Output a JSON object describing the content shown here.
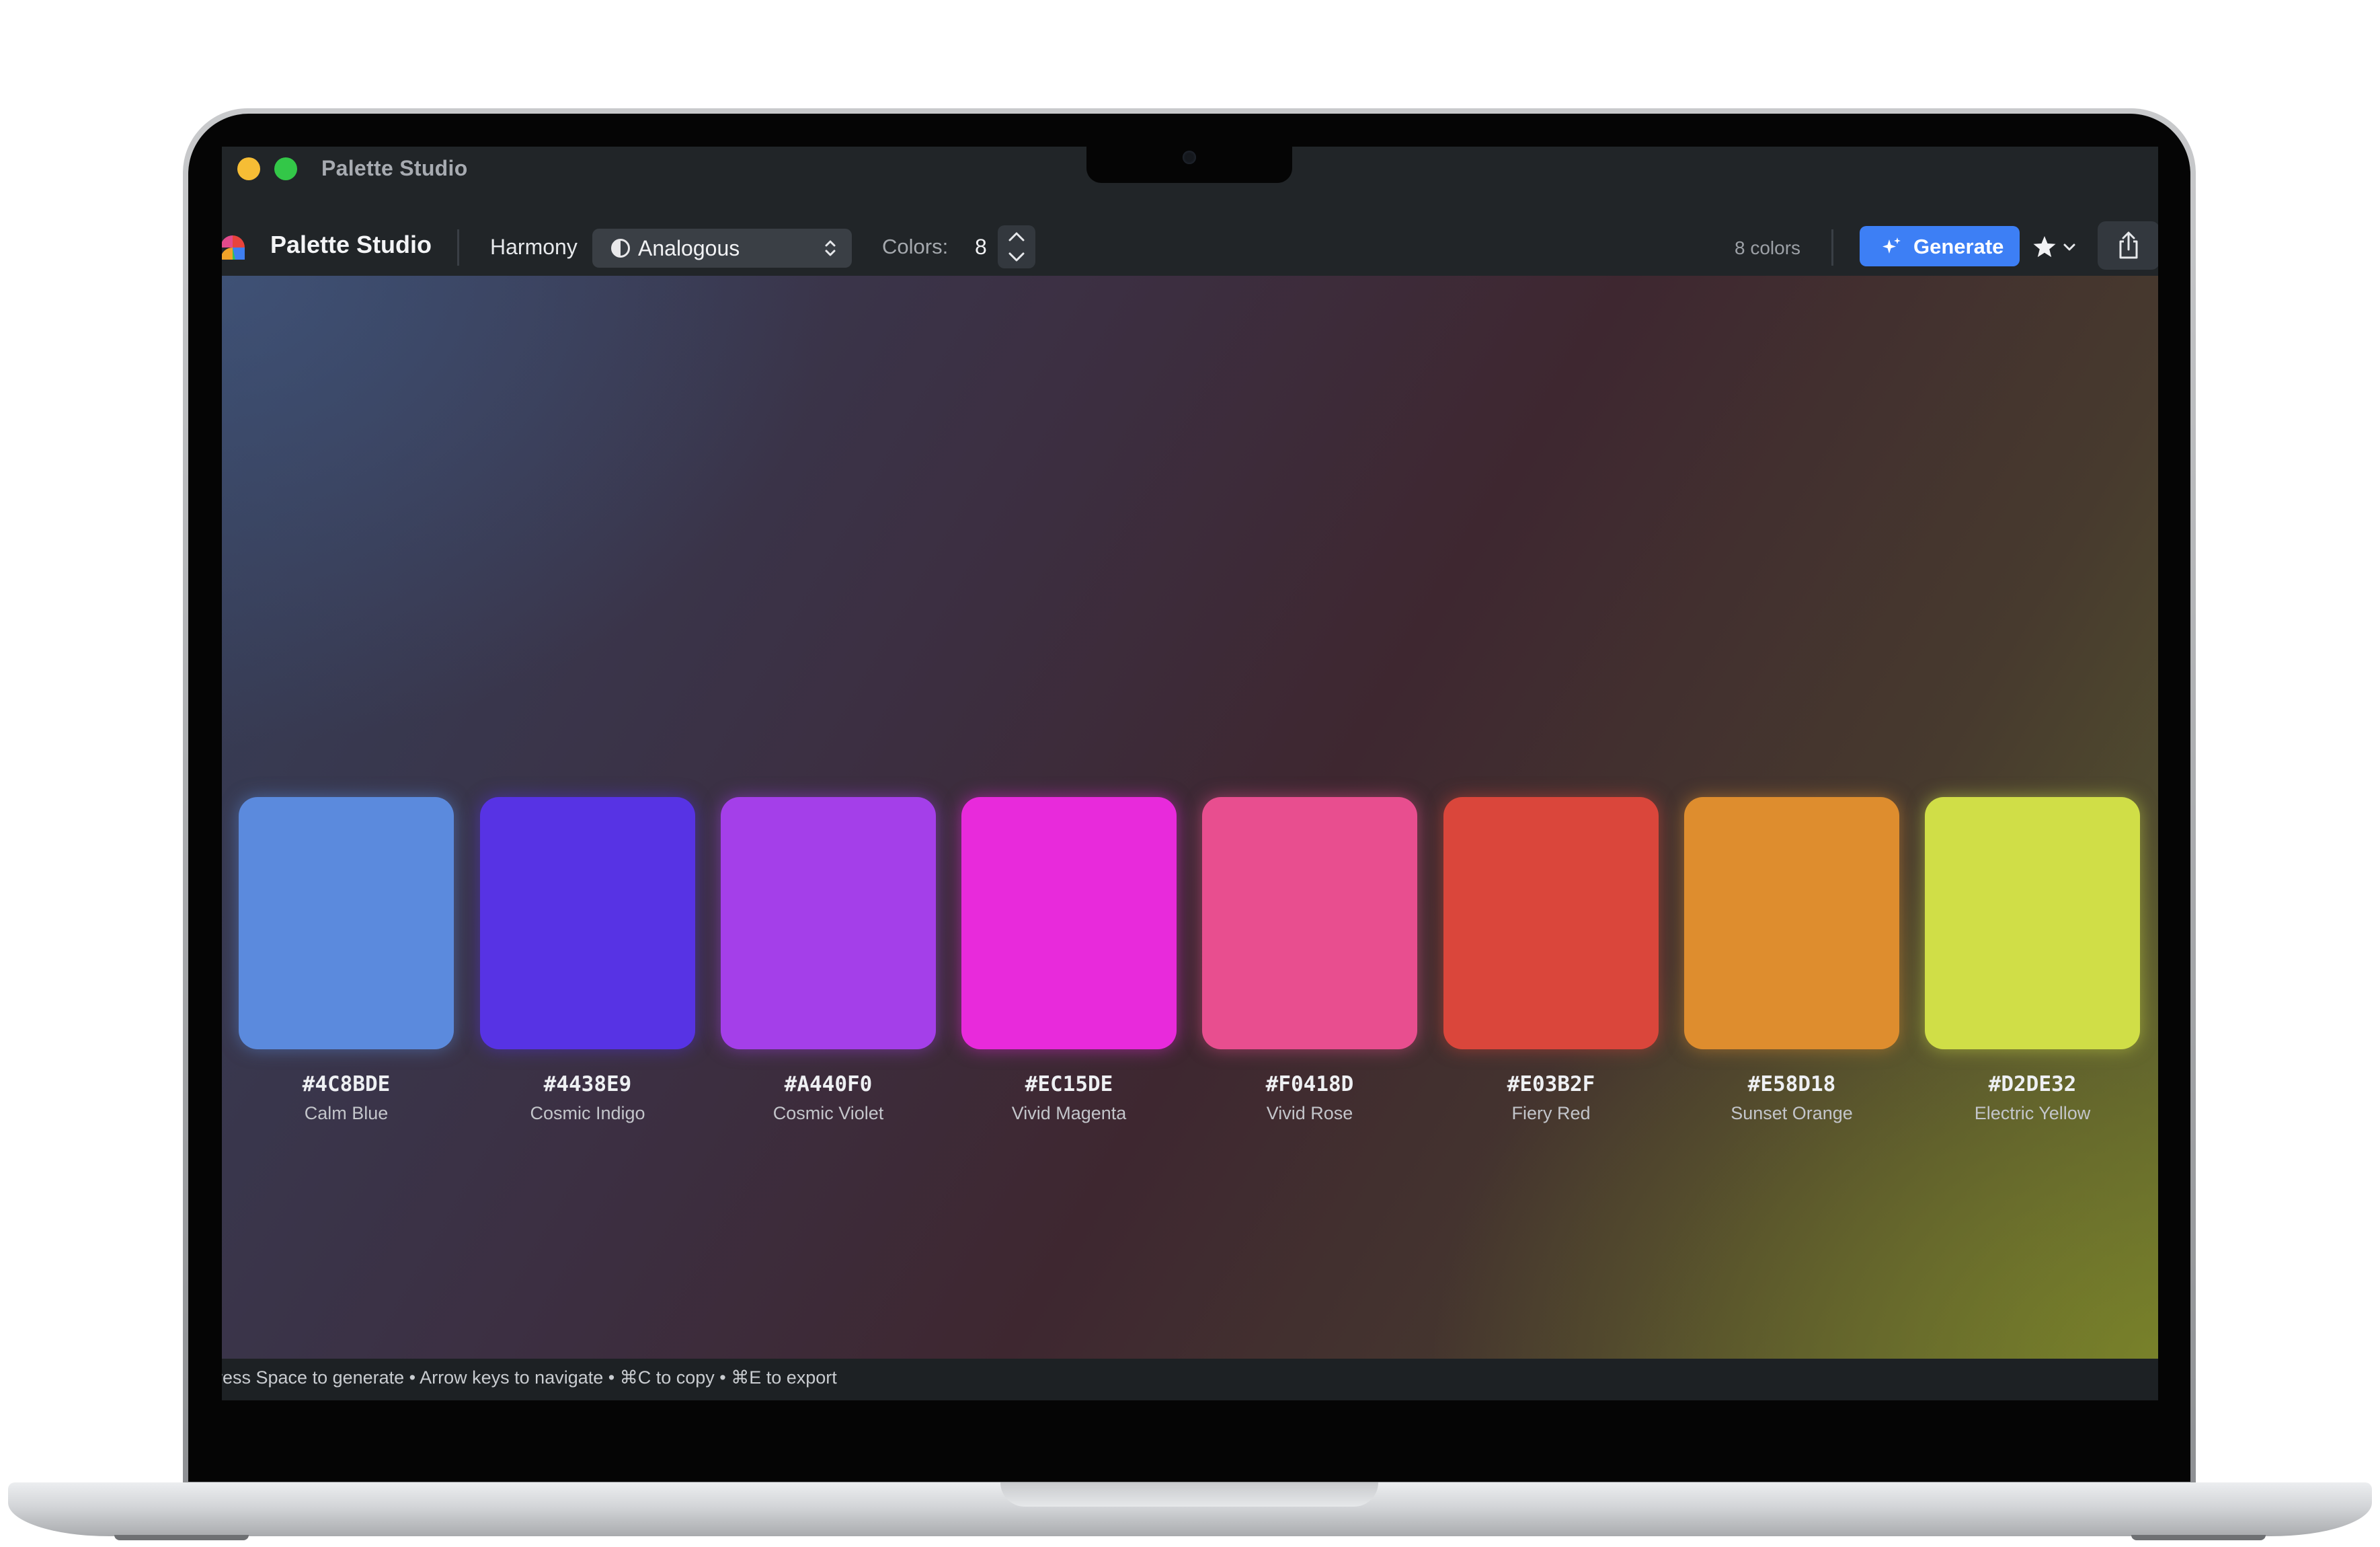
{
  "window": {
    "title": "Palette Studio"
  },
  "toolbar": {
    "app_name": "Palette Studio",
    "harmony_label": "Harmony",
    "harmony_value": "Analogous",
    "colors_label": "Colors:",
    "colors_value": "8",
    "count_label": "8 colors",
    "generate_label": "Generate"
  },
  "swatches": [
    {
      "hex": "#4C8BDE",
      "name": "Calm Blue",
      "color": "#5b8add"
    },
    {
      "hex": "#4438E9",
      "name": "Cosmic Indigo",
      "color": "#5733e4"
    },
    {
      "hex": "#A440F0",
      "name": "Cosmic Violet",
      "color": "#a43fe9"
    },
    {
      "hex": "#EC15DE",
      "name": "Vivid Magenta",
      "color": "#e82adb"
    },
    {
      "hex": "#F0418D",
      "name": "Vivid Rose",
      "color": "#e84e8f"
    },
    {
      "hex": "#E03B2F",
      "name": "Fiery Red",
      "color": "#da463b"
    },
    {
      "hex": "#E58D18",
      "name": "Sunset Orange",
      "color": "#de8d2e"
    },
    {
      "hex": "#D2DE32",
      "name": "Electric Yellow",
      "color": "#d0de47"
    }
  ],
  "status": {
    "hint": "ress Space to generate • Arrow keys to navigate • ⌘C to copy • ⌘E to export"
  },
  "colors": {
    "accent": "#3d7ff5"
  }
}
